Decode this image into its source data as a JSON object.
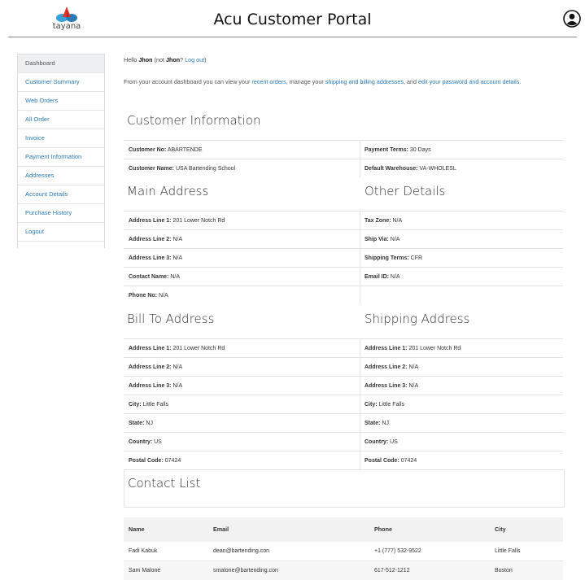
{
  "header": {
    "logo_text": "tayana",
    "title": "Acu Customer Portal"
  },
  "sidebar": {
    "items": [
      {
        "label": "Dashboard",
        "active": true
      },
      {
        "label": "Customer Summary"
      },
      {
        "label": "Web Orders"
      },
      {
        "label": "All Order"
      },
      {
        "label": "Invoice"
      },
      {
        "label": "Payment Information"
      },
      {
        "label": "Addresses"
      },
      {
        "label": "Account Details"
      },
      {
        "label": "Purchase History"
      },
      {
        "label": "Logout"
      }
    ]
  },
  "greeting": {
    "hello": "Hello",
    "name": "Jhon",
    "not_prefix": "(not",
    "not_name": "Jhon",
    "logout_link": "Log out",
    "suffix": ")"
  },
  "intro": {
    "t1": "From your account dashboard you can view your",
    "l1": "recent orders",
    "t2": ", manage your",
    "l2": "shipping and billing addresses",
    "t3": ", and",
    "l3": "edit your password and account details",
    "t4": "."
  },
  "customer_info": {
    "title": "Customer Information",
    "customer_no": {
      "label": "Customer No:",
      "value": "ABARTENDE"
    },
    "payment_terms": {
      "label": "Payment Terms:",
      "value": "30 Days"
    },
    "customer_name": {
      "label": "Customer Name:",
      "value": "USA Bartending School"
    },
    "default_warehouse": {
      "label": "Default Warehouse:",
      "value": "VA-WHOLESL"
    }
  },
  "main_address": {
    "title": "Main Address",
    "line1": {
      "label": "Address Line 1:",
      "value": "201 Lower Notch Rd"
    },
    "line2": {
      "label": "Address Line 2:",
      "value": "N/A"
    },
    "line3": {
      "label": "Address Line 3:",
      "value": "N/A"
    },
    "contact": {
      "label": "Contact Name:",
      "value": "N/A"
    },
    "phone": {
      "label": "Phone No:",
      "value": "N/A"
    }
  },
  "other_details": {
    "title": "Other Details",
    "tax_zone": {
      "label": "Tax Zone:",
      "value": "N/A"
    },
    "ship_via": {
      "label": "Ship Via:",
      "value": "N/A"
    },
    "shipping_terms": {
      "label": "Shipping Terms:",
      "value": "CFR"
    },
    "email": {
      "label": "Email ID:",
      "value": "N/A"
    }
  },
  "bill_to": {
    "title": "Bill To Address",
    "line1": {
      "label": "Address Line 1:",
      "value": "201 Lower Notch Rd"
    },
    "line2": {
      "label": "Address Line 2:",
      "value": "N/A"
    },
    "line3": {
      "label": "Address Line 3:",
      "value": "N/A"
    },
    "city": {
      "label": "City:",
      "value": "Little Falls"
    },
    "state": {
      "label": "State:",
      "value": "NJ"
    },
    "country": {
      "label": "Country:",
      "value": "US"
    },
    "postal": {
      "label": "Postal Code:",
      "value": "07424"
    }
  },
  "shipping": {
    "title": "Shipping Address",
    "line1": {
      "label": "Address Line 1:",
      "value": "201 Lower Notch Rd"
    },
    "line2": {
      "label": "Address Line 2:",
      "value": "N/A"
    },
    "line3": {
      "label": "Address Line 3:",
      "value": "N/A"
    },
    "city": {
      "label": "City:",
      "value": "Little Falls"
    },
    "state": {
      "label": "State:",
      "value": "NJ"
    },
    "country": {
      "label": "Country:",
      "value": "US"
    },
    "postal": {
      "label": "Postal Code:",
      "value": "07424"
    }
  },
  "contacts": {
    "title": "Contact List",
    "headers": {
      "name": "Name",
      "email": "Email",
      "phone": "Phone",
      "city": "City"
    },
    "rows": [
      {
        "name": "Fadi Kabuk",
        "email": "dean@bartending.con",
        "phone": "+1 (777) 532-9522",
        "city": "Little Falls"
      },
      {
        "name": "Sam Malone",
        "email": "smalone@bartending.con",
        "phone": "617-512-1212",
        "city": "Boston"
      }
    ]
  },
  "colors": {
    "link": "#2b7bb9",
    "logo_blue": "#2b7bb9",
    "logo_red": "#e0352b"
  }
}
